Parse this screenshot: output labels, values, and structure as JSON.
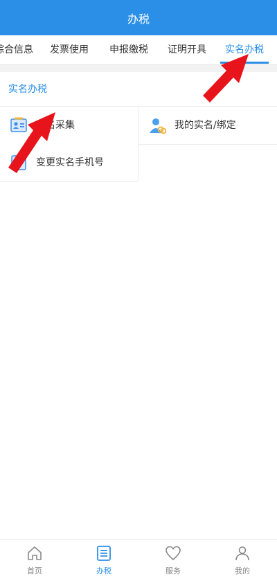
{
  "header": {
    "title": "办税"
  },
  "tabs": [
    {
      "label": "综合信息"
    },
    {
      "label": "发票使用"
    },
    {
      "label": "申报缴税"
    },
    {
      "label": "证明开具"
    },
    {
      "label": "实名办税",
      "active": true
    }
  ],
  "section": {
    "title": "实名办税"
  },
  "items": [
    {
      "label": "实名采集",
      "icon": "id-card-icon"
    },
    {
      "label": "我的实名/绑定",
      "icon": "user-link-icon"
    },
    {
      "label": "变更实名手机号",
      "icon": "phone-edit-icon"
    }
  ],
  "bottom_nav": [
    {
      "label": "首页",
      "icon": "home-icon"
    },
    {
      "label": "办税",
      "icon": "list-icon",
      "active": true
    },
    {
      "label": "服务",
      "icon": "heart-icon"
    },
    {
      "label": "我的",
      "icon": "person-icon"
    }
  ],
  "colors": {
    "accent": "#2b8fe8",
    "arrow": "#e8141b"
  }
}
